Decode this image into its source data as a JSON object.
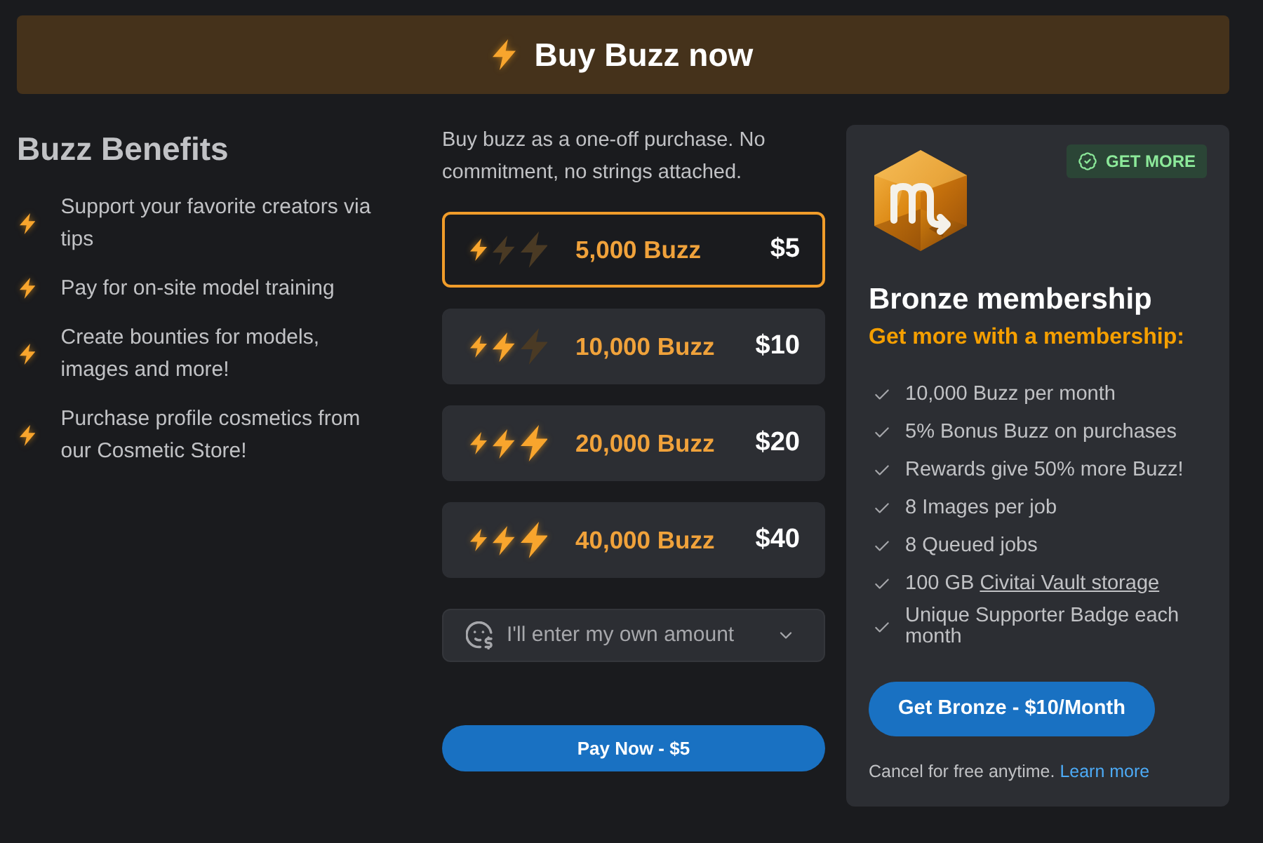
{
  "banner": {
    "title": "Buy Buzz now"
  },
  "benefits": {
    "title": "Buzz Benefits",
    "items": [
      "Support your favorite creators via tips",
      "Pay for on-site model training",
      "Create bounties for models, images and more!",
      "Purchase profile cosmetics from our Cosmetic Store!"
    ]
  },
  "purchase": {
    "intro": "Buy buzz as a one-off purchase. No commitment, no strings attached.",
    "options": [
      {
        "amount": "5,000 Buzz",
        "price": "$5",
        "bolts": [
          {
            "lit": true
          },
          {
            "lit": false
          },
          {
            "lit": false
          }
        ],
        "selected": true
      },
      {
        "amount": "10,000 Buzz",
        "price": "$10",
        "bolts": [
          {
            "lit": true
          },
          {
            "lit": true
          },
          {
            "lit": false
          }
        ],
        "selected": false
      },
      {
        "amount": "20,000 Buzz",
        "price": "$20",
        "bolts": [
          {
            "lit": true
          },
          {
            "lit": true
          },
          {
            "lit": true
          }
        ],
        "selected": false
      },
      {
        "amount": "40,000 Buzz",
        "price": "$40",
        "bolts": [
          {
            "lit": true
          },
          {
            "lit": true
          },
          {
            "lit": true
          }
        ],
        "selected": false
      }
    ],
    "custom_amount": {
      "label": "I'll enter my own amount",
      "expanded": false
    },
    "pay_button": "Pay Now - $5"
  },
  "membership": {
    "badge": "GET MORE",
    "title": "Bronze membership",
    "subtitle": "Get more with a membership:",
    "features": [
      {
        "text": "10,000 Buzz per month"
      },
      {
        "text": "5% Bonus Buzz on purchases"
      },
      {
        "text": "Rewards give 50% more Buzz!"
      },
      {
        "text": "8 Images per job"
      },
      {
        "text": "8 Queued jobs"
      },
      {
        "text": "100 GB",
        "link": "Civitai Vault storage"
      },
      {
        "text": "Unique Supporter Badge each month"
      }
    ],
    "button": "Get Bronze - $10/Month",
    "note": "Cancel for free anytime.",
    "note_link": "Learn more"
  }
}
